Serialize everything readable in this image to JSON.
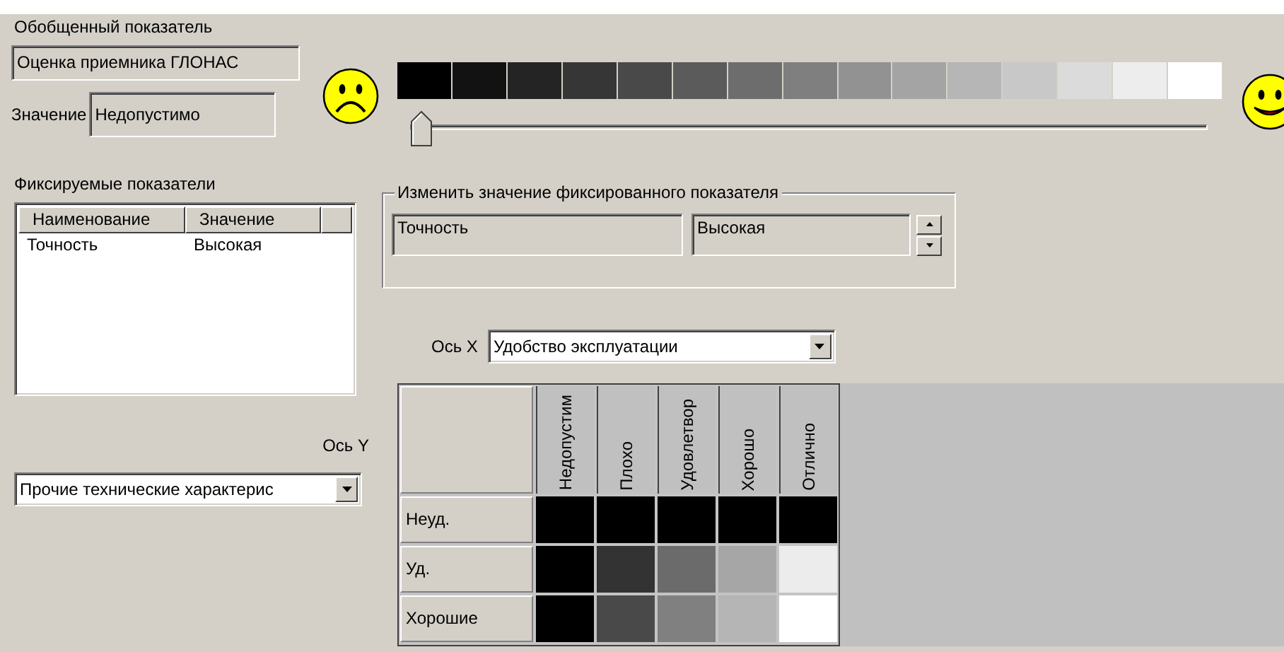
{
  "summary": {
    "label": "Обобщенный показатель",
    "name": "Оценка приемника ГЛОНАС",
    "value_label": "Значение",
    "value": "Недопустимо"
  },
  "scale": {
    "swatches": [
      {
        "color": "#000000"
      },
      {
        "color": "#121212"
      },
      {
        "color": "#242424"
      },
      {
        "color": "#363636"
      },
      {
        "color": "#494949"
      },
      {
        "color": "#5b5b5b"
      },
      {
        "color": "#6d6d6d"
      },
      {
        "color": "#7f7f7f"
      },
      {
        "color": "#929292"
      },
      {
        "color": "#a4a4a4"
      },
      {
        "color": "#b6b6b6"
      },
      {
        "color": "#c8c8c8"
      },
      {
        "color": "#dbdbdb"
      },
      {
        "color": "#ededed"
      },
      {
        "color": "#ffffff"
      }
    ],
    "level": 0
  },
  "fixed": {
    "label": "Фиксируемые показатели",
    "columns": [
      "Наименование",
      "Значение"
    ],
    "rows": [
      {
        "name": "Точность",
        "value": "Высокая"
      }
    ]
  },
  "axis_y": {
    "label": "Ось Y",
    "value": "Прочие технические характерис"
  },
  "edit": {
    "legend": "Изменить значение фиксированного показателя",
    "name": "Точность",
    "value": "Высокая"
  },
  "axis_x": {
    "label": "Ось X",
    "value": "Удобство эксплуатации"
  },
  "matrix": {
    "columns": [
      "Недопустим",
      "Плохо",
      "Удовлетвор",
      "Хорошо",
      "Отлично"
    ],
    "rows": [
      {
        "label": "Неуд.",
        "cells": [
          {
            "color": "#000000"
          },
          {
            "color": "#000000"
          },
          {
            "color": "#000000"
          },
          {
            "color": "#000000"
          },
          {
            "color": "#000000"
          }
        ]
      },
      {
        "label": "Уд.",
        "cells": [
          {
            "color": "#000000"
          },
          {
            "color": "#333333"
          },
          {
            "color": "#6b6b6b"
          },
          {
            "color": "#a6a6a6"
          },
          {
            "color": "#ececec"
          }
        ]
      },
      {
        "label": "Хорошие",
        "cells": [
          {
            "color": "#000000"
          },
          {
            "color": "#494949"
          },
          {
            "color": "#808080"
          },
          {
            "color": "#b5b5b5"
          },
          {
            "color": "#ffffff"
          }
        ]
      }
    ]
  }
}
